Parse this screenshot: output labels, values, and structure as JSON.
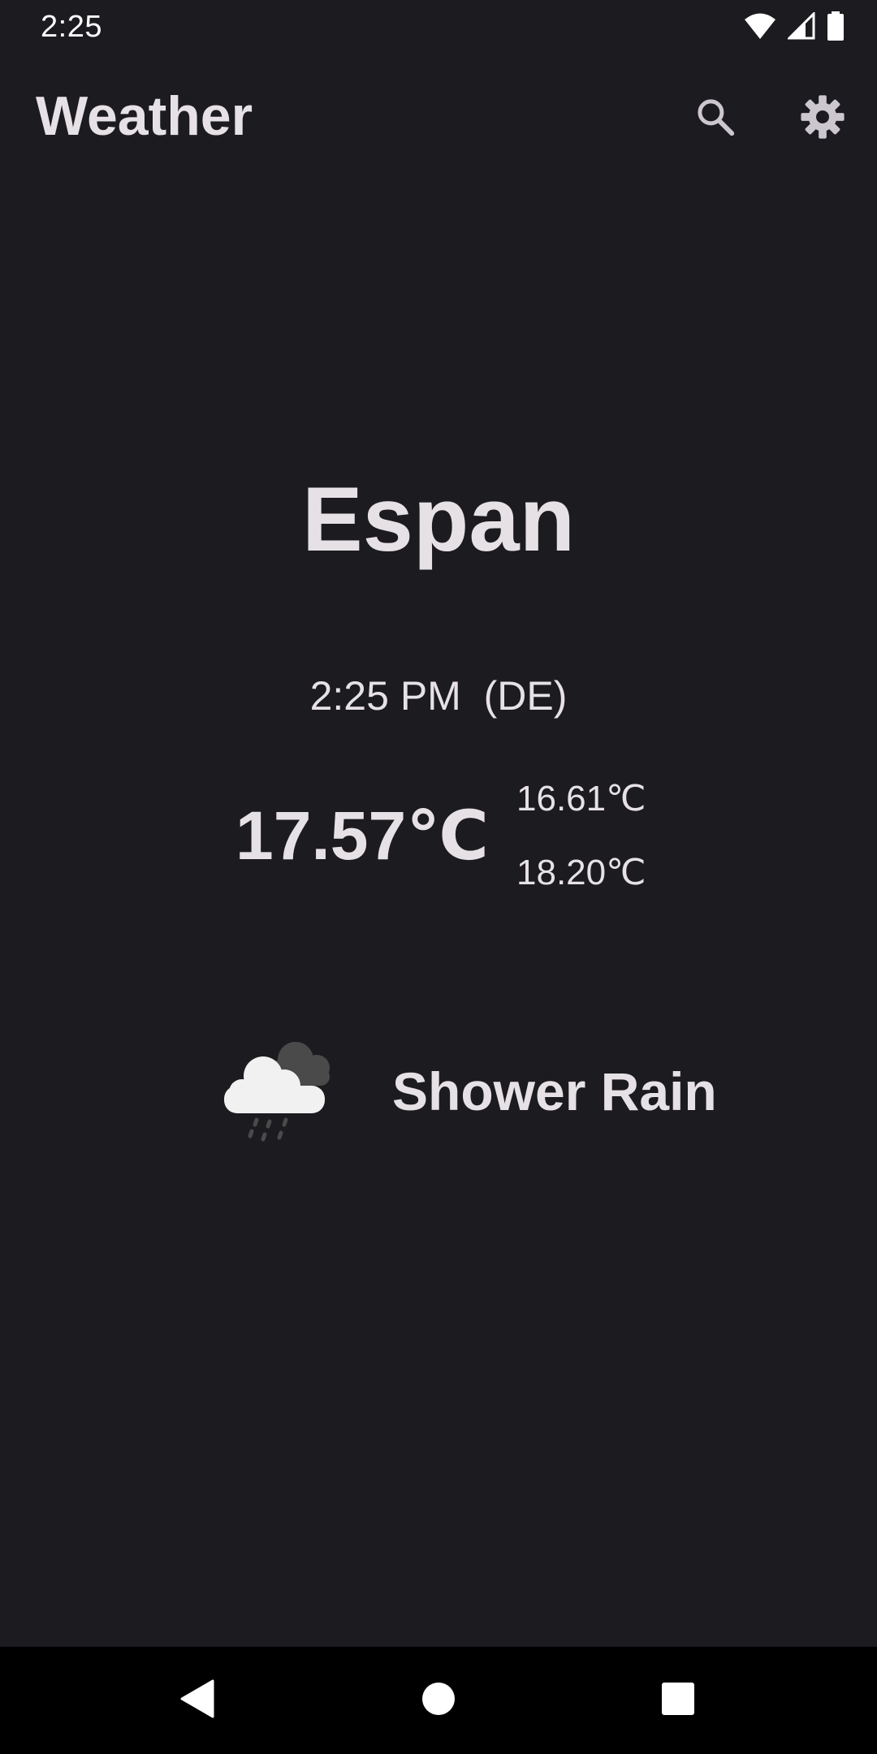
{
  "status_bar": {
    "time": "2:25",
    "icons": [
      "wifi-icon",
      "cellular-signal-icon",
      "battery-icon"
    ]
  },
  "app_bar": {
    "title": "Weather",
    "actions": [
      "search-icon",
      "settings-gear-icon"
    ]
  },
  "weather": {
    "city": "Espan",
    "local_time": "2:25 PM",
    "country_code": "(DE)",
    "temperature": "17.57℃",
    "temp_min": "16.61℃",
    "temp_max": "18.20℃",
    "condition_icon": "shower-rain-icon",
    "condition": "Shower Rain"
  },
  "nav_bar": {
    "buttons": [
      "back-icon",
      "home-icon",
      "recents-icon"
    ]
  },
  "colors": {
    "background": "#1c1b1f",
    "on_surface": "#e6e1e5",
    "icon": "#ccc6cf",
    "nav_background": "#000000"
  }
}
